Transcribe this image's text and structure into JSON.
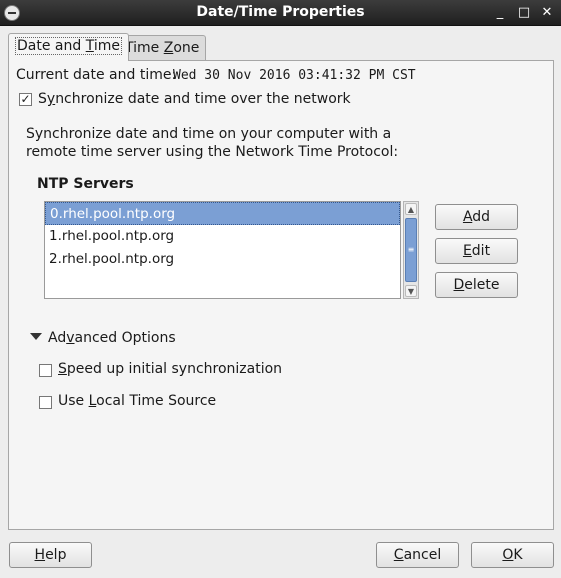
{
  "window": {
    "title": "Date/Time Properties",
    "minimize_glyph": "_",
    "maximize_glyph": "□",
    "close_glyph": "✕"
  },
  "tabs": [
    {
      "label_pre": "Date and ",
      "label_mnemonic": "T",
      "label_post": "ime",
      "active": true
    },
    {
      "label_pre": "Time ",
      "label_mnemonic": "Z",
      "label_post": "one",
      "active": false
    }
  ],
  "current": {
    "label": "Current date and time:",
    "value": "Wed 30 Nov 2016 03:41:32 PM CST"
  },
  "sync": {
    "checked": true,
    "check_glyph": "✓",
    "label_pre": "S",
    "label_mnemonic": "y",
    "label_post": "nchronize date and time over the network"
  },
  "description": {
    "line1": "Synchronize date and time on your computer with a",
    "line2": "remote time server using the Network Time Protocol:"
  },
  "ntp": {
    "heading": "NTP Servers",
    "servers": [
      "0.rhel.pool.ntp.org",
      "1.rhel.pool.ntp.org",
      "2.rhel.pool.ntp.org"
    ],
    "selected_index": 0
  },
  "buttons": {
    "add": {
      "mnemonic": "A",
      "rest": "dd"
    },
    "edit": {
      "mnemonic": "E",
      "rest": "dit"
    },
    "delete": {
      "mnemonic": "D",
      "rest": "elete"
    }
  },
  "advanced": {
    "label_pre": "Ad",
    "label_mnemonic": "v",
    "label_post": "anced Options",
    "expanded": true,
    "speed_up": {
      "checked": false,
      "label_pre": "",
      "label_mnemonic": "S",
      "label_post": "peed up initial synchronization"
    },
    "local_time": {
      "checked": false,
      "label_pre": "Use ",
      "label_mnemonic": "L",
      "label_post": "ocal Time Source"
    }
  },
  "footer": {
    "help": {
      "mnemonic": "H",
      "rest": "elp"
    },
    "cancel": {
      "mnemonic": "C",
      "rest": "ancel"
    },
    "ok": {
      "mnemonic": "O",
      "rest": "K"
    }
  },
  "scrollbar": {
    "up_glyph": "▲",
    "down_glyph": "▼",
    "grip_glyph": "≡"
  }
}
